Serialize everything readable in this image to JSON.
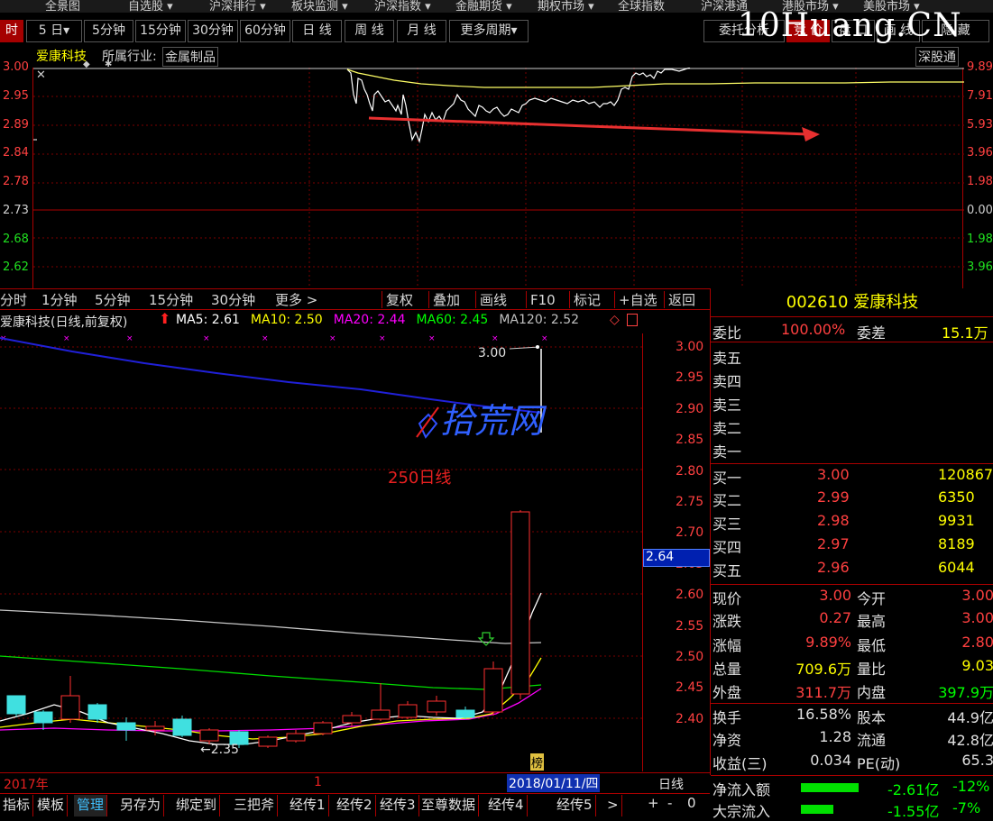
{
  "menubar": [
    "全景图",
    "自选股 ▾",
    "沪深排行 ▾",
    "板块监测 ▾",
    "沪深指数 ▾",
    "金融期货 ▾",
    "期权市场 ▾",
    "全球指数",
    "沪深港通",
    "港股市场 ▾",
    "美股市场 ▾"
  ],
  "tabs": [
    "时",
    "5 日▾",
    "5分钟",
    "15分钟",
    "30分钟",
    "60分钟",
    "日 线",
    "周 线",
    "月 线",
    "更多周期▾"
  ],
  "right_tabs": [
    "委托分析",
    "竞 价",
    "盘 口",
    "画 线",
    "隐 藏"
  ],
  "watermark": "10Huang.CN",
  "intraday": {
    "stock_name": "爱康科技",
    "industry_label": "所属行业:",
    "industry_value": "金属制品",
    "exchange": "深股通",
    "left_ticks": [
      "3.00",
      "2.95",
      "2.89",
      "2.84",
      "2.78",
      "2.73",
      "2.68",
      "2.62"
    ],
    "right_ticks": [
      "9.89%",
      "7.91%",
      "5.93%",
      "3.96%",
      "1.98%",
      "0.00%",
      "1.98%",
      "3.96%"
    ]
  },
  "kline_toolbar": [
    "分时",
    "1分钟",
    "5分钟",
    "15分钟",
    "30分钟",
    "更多 >",
    "复权",
    "叠加",
    "画线",
    "F10",
    "标记",
    "+自选",
    "返回"
  ],
  "kline": {
    "title": "爱康科技(日线,前复权)",
    "ma_labels": [
      {
        "text": "MA5: 2.61",
        "color": "#ffffff"
      },
      {
        "text": "MA10: 2.50",
        "color": "#ffff00"
      },
      {
        "text": "MA20: 2.44",
        "color": "#ff00ff"
      },
      {
        "text": "MA60: 2.45",
        "color": "#00ff00"
      },
      {
        "text": "MA120: 2.52",
        "color": "#c0c0c0"
      }
    ],
    "right_ticks": [
      "3.00",
      "2.95",
      "2.90",
      "2.85",
      "2.80",
      "2.75",
      "2.70",
      "2.65",
      "2.60",
      "2.55",
      "2.50",
      "2.45",
      "2.40"
    ],
    "current_price_tag": "2.64",
    "high_label": "3.00",
    "low_label": "←2.35",
    "annotation": "250日线",
    "logo_text": "拾荒网",
    "bang": "榜",
    "date_left": "2017年",
    "date_mid": "1",
    "date_selected": "2018/01/11/四",
    "period_label": "日线"
  },
  "quote": {
    "code": "002610",
    "name": "爱康科技",
    "weibi_label": "委比",
    "weibi_value": "100.00%",
    "weicha_label": "委差",
    "weicha_value": "15.1万",
    "sells": [
      {
        "label": "卖五",
        "price": "",
        "vol": ""
      },
      {
        "label": "卖四",
        "price": "",
        "vol": ""
      },
      {
        "label": "卖三",
        "price": "",
        "vol": ""
      },
      {
        "label": "卖二",
        "price": "",
        "vol": ""
      },
      {
        "label": "卖一",
        "price": "",
        "vol": ""
      }
    ],
    "buys": [
      {
        "label": "买一",
        "price": "3.00",
        "vol": "120867"
      },
      {
        "label": "买二",
        "price": "2.99",
        "vol": "6350"
      },
      {
        "label": "买三",
        "price": "2.98",
        "vol": "9931"
      },
      {
        "label": "买四",
        "price": "2.97",
        "vol": "8189"
      },
      {
        "label": "买五",
        "price": "2.96",
        "vol": "6044"
      }
    ],
    "stats": [
      {
        "l1": "现价",
        "v1": "3.00",
        "c1": "#ff4040",
        "l2": "今开",
        "v2": "3.00",
        "c2": "#ff4040"
      },
      {
        "l1": "涨跌",
        "v1": "0.27",
        "c1": "#ff4040",
        "l2": "最高",
        "v2": "3.00",
        "c2": "#ff4040"
      },
      {
        "l1": "涨幅",
        "v1": "9.89%",
        "c1": "#ff4040",
        "l2": "最低",
        "v2": "2.80",
        "c2": "#ff4040"
      },
      {
        "l1": "总量",
        "v1": "709.6万",
        "c1": "#ffff00",
        "l2": "量比",
        "v2": "9.03",
        "c2": "#ffff00"
      },
      {
        "l1": "外盘",
        "v1": "311.7万",
        "c1": "#ff4040",
        "l2": "内盘",
        "v2": "397.9万",
        "c2": "#00ff00"
      },
      {
        "l1": "换手",
        "v1": "16.58%",
        "c1": "#e0e0e0",
        "l2": "股本",
        "v2": "44.9亿",
        "c2": "#e0e0e0"
      },
      {
        "l1": "净资",
        "v1": "1.28",
        "c1": "#e0e0e0",
        "l2": "流通",
        "v2": "42.8亿",
        "c2": "#e0e0e0"
      },
      {
        "l1": "收益(三)",
        "v1": "0.034",
        "c1": "#e0e0e0",
        "l2": "PE(动)",
        "v2": "65.3",
        "c2": "#e0e0e0"
      }
    ],
    "flow": [
      {
        "label": "净流入额",
        "value": "-2.61亿",
        "pct": "-12%"
      },
      {
        "label": "大宗流入",
        "value": "-1.55亿",
        "pct": "-7%"
      }
    ]
  },
  "bottom_tabs": [
    "指标",
    "模板",
    "管理",
    "另存为",
    "绑定到",
    "三把斧",
    "经传1",
    "经传2",
    "经传3",
    "至尊数据",
    "经传4",
    "经传5",
    ">"
  ],
  "bottom_ctrl": [
    "+",
    "-",
    "0"
  ]
}
